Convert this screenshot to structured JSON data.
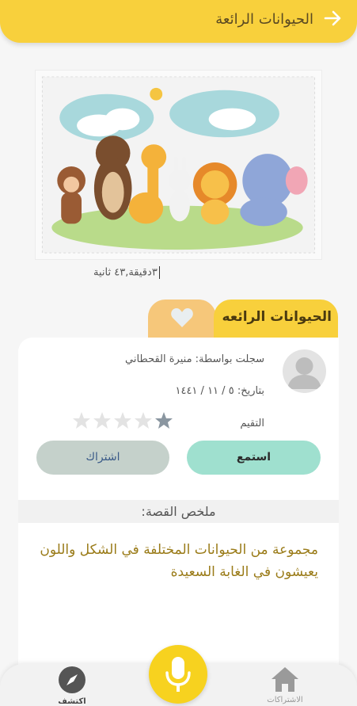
{
  "header": {
    "title": "الحيوانات الرائعة"
  },
  "story": {
    "duration": "٣دقيقة,٤٣ ثانية",
    "title_tab": "الحيوانات الرائعه",
    "recorded_by": "سجلت بواسطة: منيرة القحطاني",
    "date": "بتاريخ: ٥ / ١١ / ١٤٤١",
    "rating_label": "التقيم",
    "rating_value": 1,
    "rating_max": 5
  },
  "actions": {
    "listen_label": "استمع",
    "subscribe_label": "اشتراك"
  },
  "summary": {
    "heading": "ملخص القصة:",
    "text": "مجموعة من الحيوانات المختلفة في الشكل واللون يعيشون في الغابة السعيدة"
  },
  "nav": {
    "explore_label": "اكتشف",
    "subscriptions_label": "الاشتراكات"
  },
  "colors": {
    "header": "#f8d03c",
    "listen": "#9fe0cf",
    "subscribe": "#c5d1cb",
    "favorite_tab": "#f6c77a",
    "summary_text": "#9a7b18"
  }
}
